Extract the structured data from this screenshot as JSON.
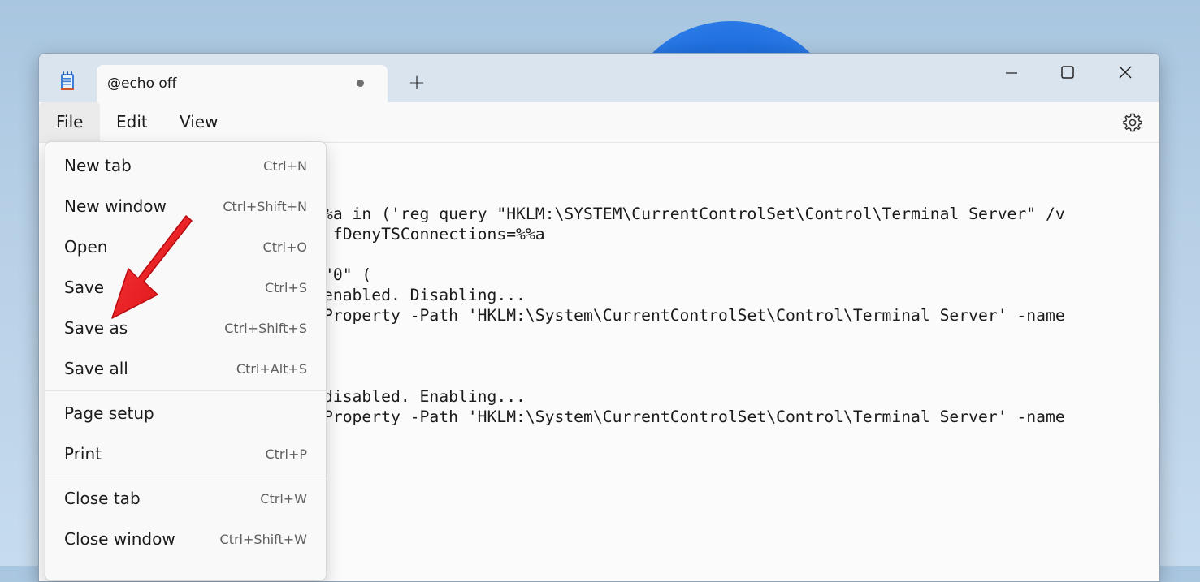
{
  "window": {
    "tab_title": "@echo off",
    "new_tab_symbol": "+"
  },
  "menubar": {
    "file": "File",
    "edit": "Edit",
    "view": "View"
  },
  "file_menu": {
    "items": [
      {
        "label": "New tab",
        "shortcut": "Ctrl+N"
      },
      {
        "label": "New window",
        "shortcut": "Ctrl+Shift+N"
      },
      {
        "label": "Open",
        "shortcut": "Ctrl+O"
      },
      {
        "label": "Save",
        "shortcut": "Ctrl+S"
      },
      {
        "label": "Save as",
        "shortcut": "Ctrl+Shift+S"
      },
      {
        "label": "Save all",
        "shortcut": "Ctrl+Alt+S"
      },
      {
        "label": "Page setup",
        "shortcut": ""
      },
      {
        "label": "Print",
        "shortcut": "Ctrl+P"
      },
      {
        "label": "Close tab",
        "shortcut": "Ctrl+W"
      },
      {
        "label": "Close window",
        "shortcut": "Ctrl+Shift+W"
      }
    ]
  },
  "editor": {
    "lines": [
      "%a in ('reg query \"HKLM:\\SYSTEM\\CurrentControlSet\\Control\\Terminal Server\" /v",
      " fDenyTSConnections=%%a",
      "\"0\" (",
      "enabled. Disabling...",
      "Property -Path 'HKLM:\\System\\CurrentControlSet\\Control\\Terminal Server' -name",
      "disabled. Enabling...",
      "Property -Path 'HKLM:\\System\\CurrentControlSet\\Control\\Terminal Server' -name"
    ]
  },
  "colors": {
    "titlebar": "#d9e4ef",
    "arrow": "#e8151b",
    "wallpaper_accent": "#1f6fe0"
  },
  "icons": {
    "app": "notepad-icon",
    "minimize": "minimize-icon",
    "maximize": "maximize-icon",
    "close": "close-icon",
    "settings": "gear-icon",
    "annotation": "red-arrow-pointer"
  }
}
